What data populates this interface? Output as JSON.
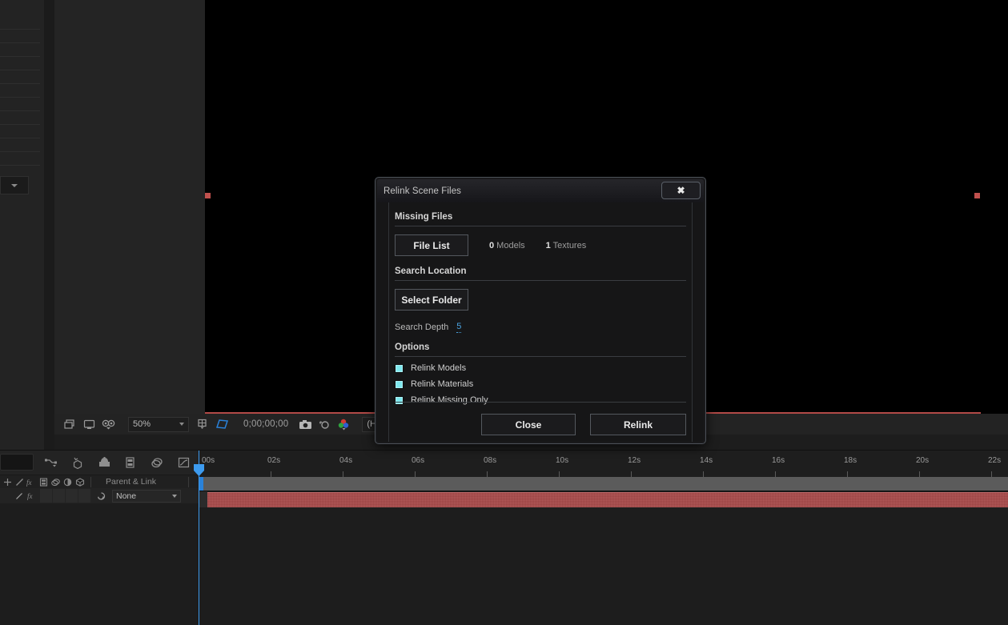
{
  "viewer": {
    "toolbar": {
      "zoom_level": "50%",
      "timecode": "0;00;00;00",
      "resolution": "(Half)",
      "icons": [
        "toggle-transparency-grid-icon",
        "toggle-view-layout-icon",
        "3d-view-icon",
        "region-of-interest-icon",
        "toggle-mask-paths-icon",
        "take-snapshot-icon",
        "show-snapshot-icon",
        "show-channel-icon"
      ]
    }
  },
  "timeline": {
    "toolbar_icons": [
      "motion-blur-icon",
      "graph-editor-icon",
      "brainstorm-icon",
      "frame-blend-icon",
      "shy-layers-icon",
      "graph-curve-icon"
    ],
    "column_header": {
      "switch_icons": [
        "shy-icon",
        "collapse-transformations-icon",
        "effects-fx-icon",
        "frame-blending-icon",
        "motion-blur-icon",
        "adjustment-layer-icon",
        "three-d-layer-icon"
      ],
      "parent_link": "Parent & Link"
    },
    "layer_row": {
      "parent_value": "None",
      "fx_label": "fx"
    },
    "ruler_labels": [
      "00s",
      "02s",
      "04s",
      "06s",
      "08s",
      "10s",
      "12s",
      "14s",
      "16s",
      "18s",
      "20s",
      "22s"
    ],
    "playhead_time": "00s"
  },
  "dialog": {
    "title": "Relink Scene Files",
    "close_icon_label": "✖",
    "sections": {
      "missing_files": {
        "heading": "Missing Files",
        "file_list_button": "File List",
        "counts": [
          {
            "value": "0",
            "label": " Models"
          },
          {
            "value": "1",
            "label": " Textures"
          }
        ]
      },
      "search_location": {
        "heading": "Search Location",
        "select_folder_button": "Select Folder",
        "depth_label": "Search Depth",
        "depth_value": "5"
      },
      "options": {
        "heading": "Options",
        "items": [
          {
            "label": "Relink Models",
            "checked": true
          },
          {
            "label": "Relink Materials",
            "checked": true
          },
          {
            "label": "Relink Missing Only",
            "checked": true
          }
        ]
      }
    },
    "footer": {
      "close_button": "Close",
      "relink_button": "Relink"
    }
  },
  "colors": {
    "accent_blue": "#3d9bef",
    "checkbox_cyan": "#7fe8ee",
    "layer_bar_red": "#ab4a4a",
    "handle_red": "#c0504d",
    "link_blue": "#4aa3e0"
  }
}
